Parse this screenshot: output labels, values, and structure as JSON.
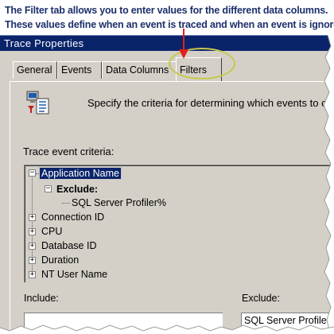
{
  "caption": {
    "line1": "The Filter tab allows you to enter values for the different data columns.",
    "line2": "These values define when an event is traced and when an event is ignored."
  },
  "window": {
    "title": "Trace Properties"
  },
  "tabs": [
    {
      "label": "General",
      "active": false
    },
    {
      "label": "Events",
      "active": false
    },
    {
      "label": "Data Columns",
      "active": false
    },
    {
      "label": "Filters",
      "active": true
    }
  ],
  "intro_text": "Specify the criteria for determining which events to c",
  "criteria": {
    "label": "Trace event criteria:",
    "tree": [
      {
        "label": "Application Name",
        "expander": "−",
        "selected": true
      },
      {
        "label": "Exclude:",
        "expander": "−",
        "bold": true
      },
      {
        "label": "SQL Server Profiler%"
      },
      {
        "label": "Connection ID",
        "expander": "+"
      },
      {
        "label": "CPU",
        "expander": "+"
      },
      {
        "label": "Database ID",
        "expander": "+"
      },
      {
        "label": "Duration",
        "expander": "+"
      },
      {
        "label": "NT User Name",
        "expander": "+"
      }
    ]
  },
  "include": {
    "label": "Include:",
    "value": ""
  },
  "exclude": {
    "label": "Exclude:",
    "value": "SQL Server Profiler"
  },
  "colors": {
    "titlebar": "#0a246a",
    "caption_text": "#1c2f6b",
    "highlight_ellipse": "#c7c74a",
    "arrow": "#e02020",
    "dialog_face": "#d4d0c8"
  }
}
